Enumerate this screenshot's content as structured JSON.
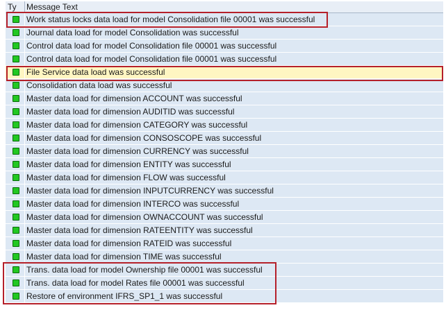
{
  "header": {
    "type_col": "Ty",
    "message_col": "Message Text"
  },
  "status_color": "#22c822",
  "highlight_color": "#b5202a",
  "selected_row_color": "#fff6c2",
  "rows": [
    {
      "status": "success",
      "text": "Work status locks data load for model Consolidation file 00001 was successful"
    },
    {
      "status": "success",
      "text": "Journal data load for model Consolidation was successful"
    },
    {
      "status": "success",
      "text": "Control data load for model Consolidation file 00001 was successful"
    },
    {
      "status": "success",
      "text": "Control data load for model Consolidation file 00001 was successful"
    },
    {
      "status": "success",
      "text": "File Service data load was successful"
    },
    {
      "status": "success",
      "text": "Consolidation data load was successful"
    },
    {
      "status": "success",
      "text": "Master data load for dimension ACCOUNT was successful"
    },
    {
      "status": "success",
      "text": "Master data load for dimension AUDITID was successful"
    },
    {
      "status": "success",
      "text": "Master data load for dimension CATEGORY was successful"
    },
    {
      "status": "success",
      "text": "Master data load for dimension CONSOSCOPE was successful"
    },
    {
      "status": "success",
      "text": "Master data load for dimension CURRENCY was successful"
    },
    {
      "status": "success",
      "text": "Master data load for dimension ENTITY was successful"
    },
    {
      "status": "success",
      "text": "Master data load for dimension FLOW was successful"
    },
    {
      "status": "success",
      "text": "Master data load for dimension INPUTCURRENCY was successful"
    },
    {
      "status": "success",
      "text": "Master data load for dimension INTERCO was successful"
    },
    {
      "status": "success",
      "text": "Master data load for dimension OWNACCOUNT was successful"
    },
    {
      "status": "success",
      "text": "Master data load for dimension RATEENTITY was successful"
    },
    {
      "status": "success",
      "text": "Master data load for dimension RATEID was successful"
    },
    {
      "status": "success",
      "text": "Master data load for dimension TIME was successful"
    },
    {
      "status": "success",
      "text": "Trans. data load for model Ownership file 00001 was successful"
    },
    {
      "status": "success",
      "text": "Trans. data load for model Rates file 00001 was successful"
    },
    {
      "status": "success",
      "text": "Restore of environment IFRS_SP1_1 was successful"
    }
  ]
}
